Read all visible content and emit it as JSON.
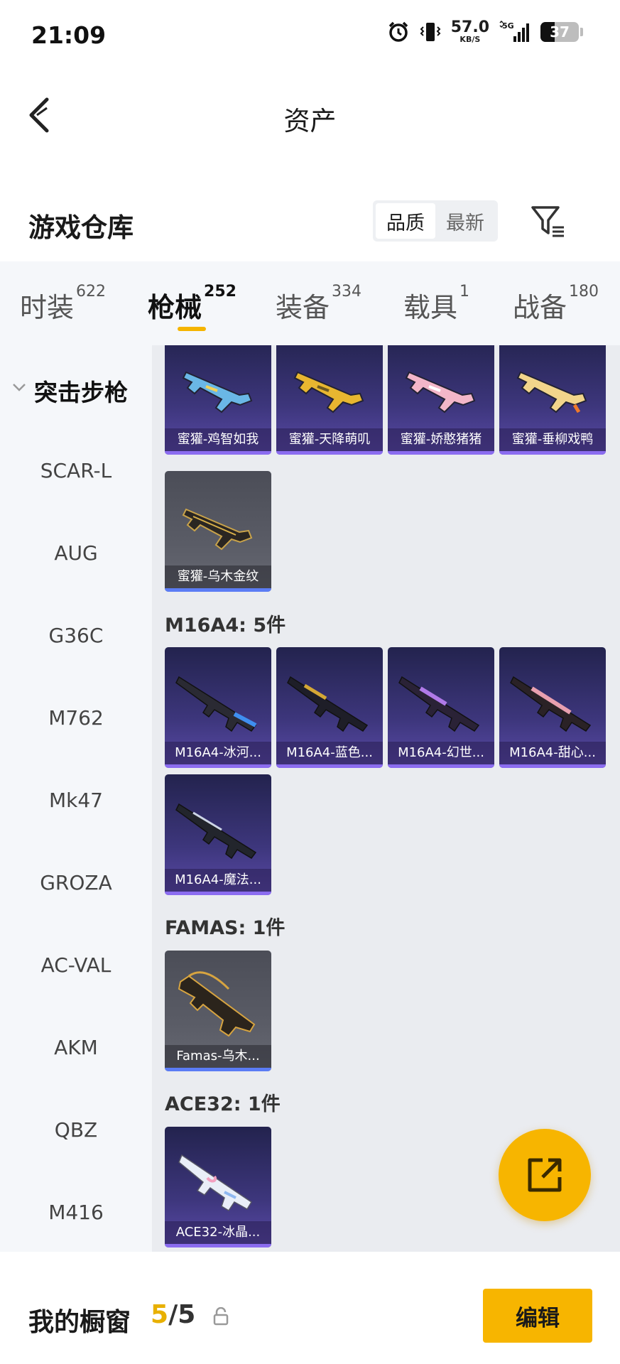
{
  "status_bar": {
    "time": "21:09",
    "speed_value": "57.0",
    "speed_unit": "KB/S",
    "network": "5G",
    "battery": "37",
    "battery_level": 0.37
  },
  "header": {
    "title": "资产"
  },
  "warehouse": {
    "title": "游戏仓库",
    "sort_options": [
      "品质",
      "最新"
    ],
    "active_sort": "品质"
  },
  "tabs": [
    {
      "label": "时装",
      "count": "622"
    },
    {
      "label": "枪械",
      "count": "252",
      "active": true
    },
    {
      "label": "装备",
      "count": "334"
    },
    {
      "label": "载具",
      "count": "1"
    },
    {
      "label": "战备",
      "count": "180"
    }
  ],
  "sidebar": {
    "items": [
      "突击步枪",
      "SCAR-L",
      "AUG",
      "G36C",
      "M762",
      "Mk47",
      "GROZA",
      "AC-VAL",
      "AKM",
      "QBZ",
      "M416"
    ]
  },
  "groups": [
    {
      "title": "",
      "items": [
        "蜜獾-鸡智如我",
        "蜜獾-天降萌叽",
        "蜜獾-娇憨猪猪",
        "蜜獾-垂柳戏鸭",
        "蜜獾-乌木金纹"
      ],
      "rarity": [
        "purple",
        "purple",
        "purple",
        "purple",
        "gray"
      ]
    },
    {
      "title": "M16A4: 5件",
      "items": [
        "M16A4-冰河...",
        "M16A4-蓝色...",
        "M16A4-幻世...",
        "M16A4-甜心...",
        "M16A4-魔法..."
      ],
      "rarity": [
        "purple",
        "purple",
        "purple",
        "purple",
        "purple"
      ]
    },
    {
      "title": "FAMAS: 1件",
      "items": [
        "Famas-乌木..."
      ],
      "rarity": [
        "gray"
      ]
    },
    {
      "title": "ACE32: 1件",
      "items": [
        "ACE32-冰晶..."
      ],
      "rarity": [
        "purple"
      ]
    }
  ],
  "bottom_bar": {
    "label": "我的橱窗",
    "count_current": "5",
    "count_separator": "/",
    "count_total": "5",
    "edit_label": "编辑"
  },
  "colors": {
    "accent": "#f7b500",
    "card_purple": "#3d367c",
    "card_gray": "#5a5c66",
    "sidebar_bg": "#f5f7fa",
    "content_bg": "#eaecf0"
  },
  "icons": {
    "back": "chevron-left-icon",
    "filter": "filter-icon",
    "fab": "share-external-icon",
    "lock": "lock-icon"
  }
}
